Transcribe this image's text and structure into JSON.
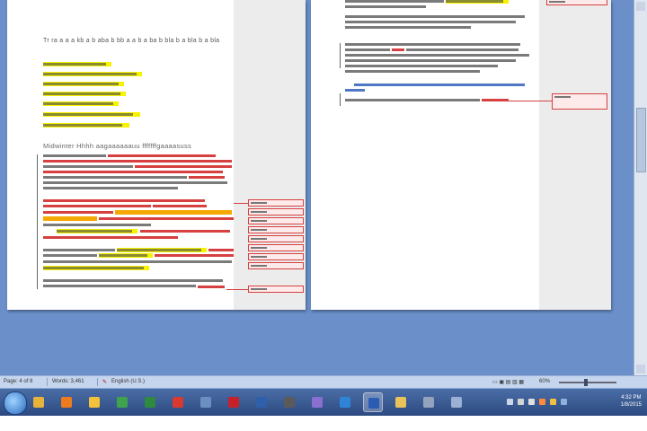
{
  "document": {
    "left_page_heading": "Tr ra a a a kb a b aba b bb a a b a ba b bla b a bla b a bla",
    "left_section_title": "Midwinter Hhhh aagaaaaaauu fffffffgaaaasuss"
  },
  "statusbar": {
    "page_info": "Page: 4 of 8",
    "words_info": "Words: 3,461",
    "language": "English (U.S.)",
    "zoom_level": "60%"
  },
  "taskbar": {
    "buttons": [
      {
        "name": "file-explorer-icon",
        "color": "#e8b33a"
      },
      {
        "name": "media-player-icon",
        "color": "#f07b1e"
      },
      {
        "name": "paint-icon",
        "color": "#f3c23a"
      },
      {
        "name": "chrome-icon",
        "color": "#3fa34d"
      },
      {
        "name": "excel-icon",
        "color": "#2d8a3e"
      },
      {
        "name": "adobe-icon",
        "color": "#d93a30"
      },
      {
        "name": "notes-icon",
        "color": "#6c8fc2"
      },
      {
        "name": "opera-icon",
        "color": "#c8202a"
      },
      {
        "name": "photos-icon",
        "color": "#2e5fa8"
      },
      {
        "name": "calendar-icon",
        "color": "#5a5a5a"
      },
      {
        "name": "maps-icon",
        "color": "#8a6fd0"
      },
      {
        "name": "outlook-icon",
        "color": "#2f84d8"
      },
      {
        "name": "word-icon",
        "color": "#2b5db5"
      },
      {
        "name": "folder-icon",
        "color": "#e9c35a"
      },
      {
        "name": "gallery-icon",
        "color": "#93a3bd"
      },
      {
        "name": "control-panel-icon",
        "color": "#9bb0d4"
      }
    ],
    "active_index": 12,
    "clock_time": "4:32 PM",
    "clock_date": "1/8/2015"
  }
}
